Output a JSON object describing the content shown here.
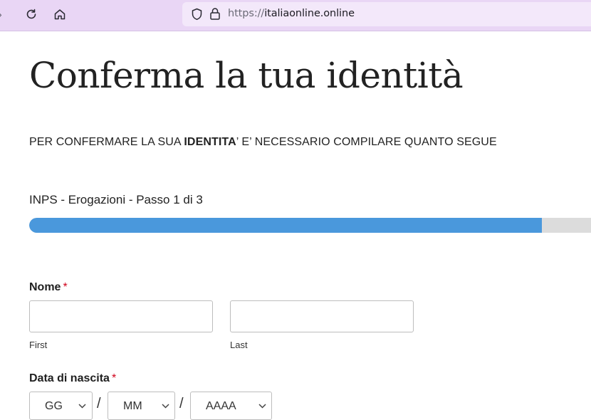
{
  "browser": {
    "url_scheme": "https://",
    "url_host": "italiaonline.online"
  },
  "page": {
    "title": "Conferma la tua identità",
    "intro_prefix": "PER CONFERMARE LA SUA ",
    "intro_bold": "IDENTITA",
    "intro_suffix": "’ E’ NECESSARIO COMPILARE QUANTO SEGUE",
    "step_label": "INPS - Erogazioni - Passo 1 di 3",
    "progress_fraction": 0.9
  },
  "form": {
    "name_label": "Nome",
    "required_mark": "*",
    "first_sublabel": "First",
    "last_sublabel": "Last",
    "first_value": "",
    "last_value": "",
    "dob_label": "Data di nascita",
    "day_value": "GG",
    "month_value": "MM",
    "year_value": "AAAA",
    "date_separator": "/"
  },
  "colors": {
    "toolbar_bg": "#e9d6f5",
    "progress_fill": "#4a98dc",
    "progress_track": "#dcdcdc",
    "required": "#d0021b"
  }
}
